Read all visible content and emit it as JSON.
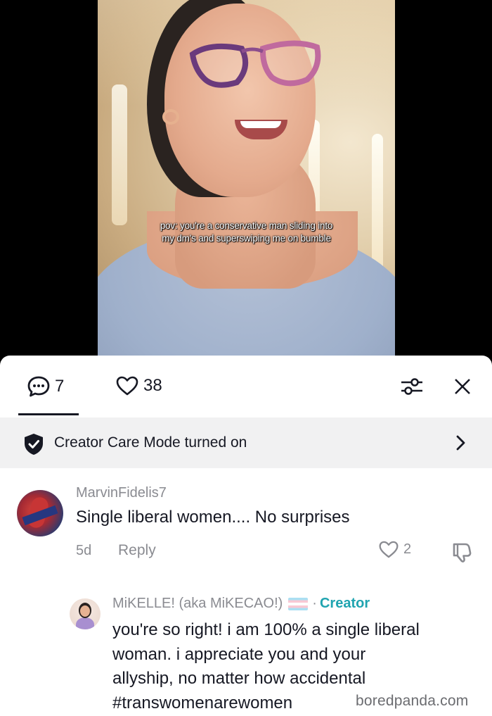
{
  "video": {
    "caption_line1": "pov: you're a conservative man sliding into",
    "caption_line2": "my dm's and superswiping me on bumble"
  },
  "stats": {
    "comments_count": "7",
    "likes_count": "38"
  },
  "creator_care": {
    "label": "Creator Care Mode turned on"
  },
  "comment": {
    "username": "MarvinFidelis7",
    "text": "Single liberal women.... No surprises",
    "age": "5d",
    "reply_label": "Reply",
    "like_count": "2"
  },
  "reply": {
    "username": "MiKELLE! (aka MiKECAO!)",
    "separator": "·",
    "badge": "Creator",
    "line1": "you're so right! i am 100% a single liberal",
    "line2": "woman. i appreciate you and your",
    "line3": "allyship, no matter how accidental",
    "line4": "#transwomenarewomen"
  },
  "watermark": "boredpanda.com",
  "colors": {
    "creator_accent": "#20a4b0",
    "muted_text": "#8a8b91",
    "primary_text": "#161823"
  },
  "icons": [
    "comment-bubble-icon",
    "heart-icon",
    "filter-sliders-icon",
    "close-icon",
    "shield-check-icon",
    "chevron-right-icon",
    "dislike-icon"
  ]
}
